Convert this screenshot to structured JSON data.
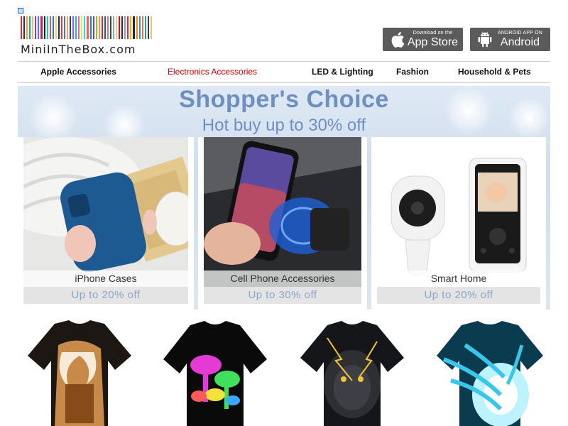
{
  "header": {
    "brand_name": "MiniInTheBox.com",
    "logo_bar_colors": [
      "#d7263d",
      "#333333",
      "#f49d37",
      "#2a9d8f",
      "#e9c46a",
      "#8338ec",
      "#3a86ff",
      "#ff006e",
      "#222222",
      "#06d6a0",
      "#ef476f",
      "#118ab2",
      "#ffd166",
      "#073b4c",
      "#e63946",
      "#457b9d",
      "#f4a261",
      "#264653",
      "#9b5de5",
      "#00bbf9",
      "#f15bb5",
      "#fee440",
      "#00f5d4",
      "#ff595e",
      "#1982c4",
      "#6a4c93",
      "#8ac926",
      "#ff924c",
      "#c5283d",
      "#255f85",
      "#e07a5f",
      "#3d405b",
      "#81b29a",
      "#f2cc8f",
      "#d90429",
      "#2b2d42",
      "#8d99ae",
      "#ef233c",
      "#ffb703",
      "#023047",
      "#fb8500",
      "#219ebc",
      "#e76f51",
      "#2a9d8f",
      "#264653",
      "#e9c46a"
    ],
    "app_store": {
      "small": "Download on the",
      "big": "App Store",
      "icon": "apple-icon"
    },
    "android": {
      "small": "ANDROID APP ON",
      "big": "Android",
      "icon": "android-icon"
    }
  },
  "nav": {
    "items": [
      "Apple Accessories",
      "Electronics Accessories",
      "LED & Lighting",
      "Fashion",
      "Household & Pets"
    ],
    "active_color": "#cc0000"
  },
  "banner": {
    "title": "Shopper's Choice",
    "subtitle": "Hot buy up to 30% off",
    "cards": [
      {
        "caption": "iPhone Cases",
        "offer": "Up to 20% off"
      },
      {
        "caption": "Cell Phone Accessories",
        "offer": "Up to 30% off"
      },
      {
        "caption": "Smart Home",
        "offer": "Up to 20% off"
      }
    ]
  },
  "products": [
    {
      "image": "tshirt-beer-print"
    },
    {
      "image": "tshirt-neon-mushroom-print"
    },
    {
      "image": "tshirt-lion-print"
    },
    {
      "image": "tshirt-binary-code-print"
    }
  ]
}
